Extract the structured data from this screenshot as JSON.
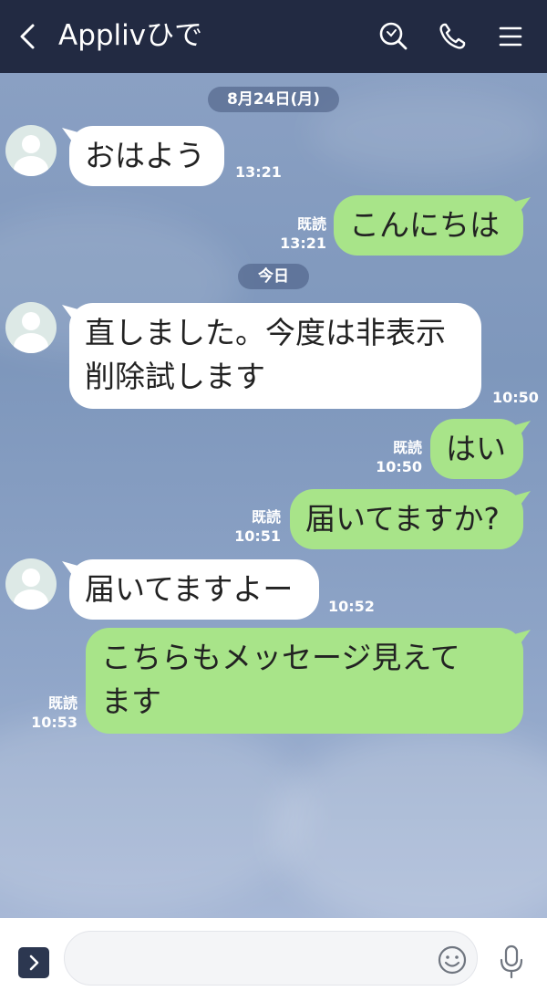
{
  "header": {
    "title": "Applivひで",
    "icons": [
      "back-icon",
      "search-icon",
      "phone-icon",
      "menu-icon"
    ],
    "bg_color": "#222a42"
  },
  "chat": {
    "date_dividers": [
      "8月24日(月)",
      "今日"
    ],
    "messages": [
      {
        "side": "in",
        "text": "おはよう",
        "time": "13:21"
      },
      {
        "side": "out",
        "text": "こんにちは",
        "read": "既読",
        "time": "13:21"
      },
      {
        "side": "in",
        "text": "直しました。今度は非表示\n削除試します",
        "time": "10:50"
      },
      {
        "side": "out",
        "text": "はい",
        "read": "既読",
        "time": "10:50"
      },
      {
        "side": "out",
        "text": "届いてますか?",
        "read": "既読",
        "time": "10:51"
      },
      {
        "side": "in",
        "text": "届いてますよー",
        "time": "10:52"
      },
      {
        "side": "out",
        "text": "こちらもメッセージ見えて\nます",
        "read": "既読",
        "time": "10:53"
      }
    ],
    "colors": {
      "incoming_bubble": "#ffffff",
      "outgoing_bubble": "#a8e489",
      "background": "#7f98bd"
    }
  },
  "footer": {
    "input_value": "",
    "icons": [
      "chevron-right-icon",
      "emoji-icon",
      "microphone-icon"
    ]
  }
}
